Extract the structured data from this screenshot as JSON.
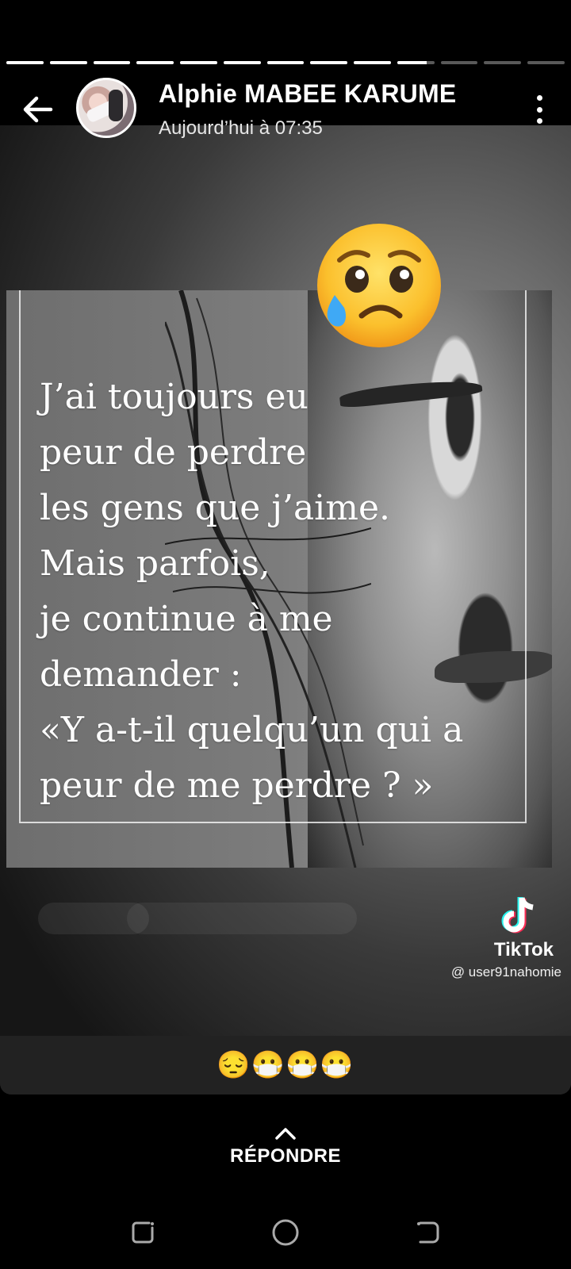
{
  "progress": {
    "segments_total": 13,
    "segments_complete": 9,
    "current_segment_fraction": 0.8
  },
  "header": {
    "user_name": "Alphie MABEE KARUME",
    "timestamp": "Aujourd’hui à 07:35",
    "back_icon": "arrow-left-icon",
    "menu_icon": "more-vertical-icon"
  },
  "story": {
    "quote_lines": [
      "J’ai toujours eu",
      "peur de perdre",
      "les gens que j’aime.",
      "Mais parfois,",
      "je continue à me",
      "demander :",
      "«Y a-t-il quelqu’un qui a",
      "peur de me perdre ? »"
    ],
    "sticker_emoji": "crying-face",
    "watermark": {
      "brand": "TikTok",
      "username": "@ user91nahomie"
    }
  },
  "caption": {
    "text": "😔😷😷😷"
  },
  "reply": {
    "label": "RÉPONDRE"
  },
  "navigation": {
    "recent_icon": "recent-apps-icon",
    "home_icon": "home-icon",
    "back_icon": "back-icon"
  }
}
